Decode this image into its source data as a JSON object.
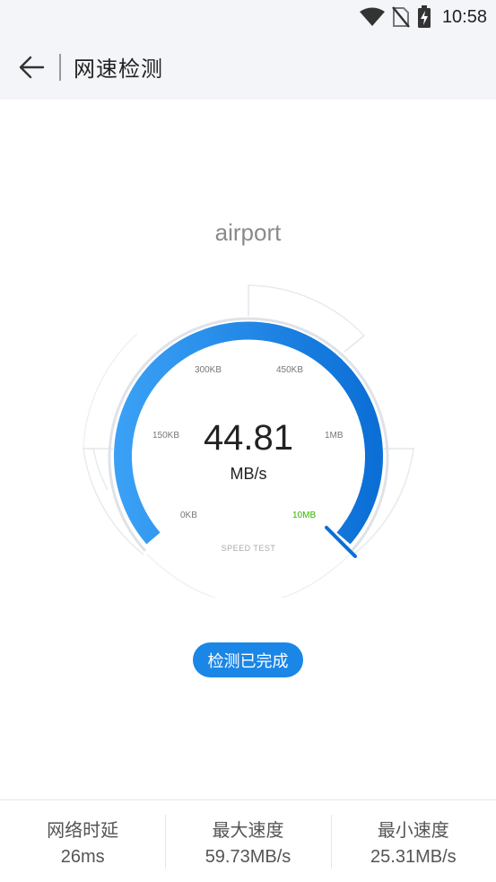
{
  "status_bar": {
    "time": "10:58",
    "icons": [
      "wifi-icon",
      "no-sim-icon",
      "battery-charging-icon"
    ]
  },
  "toolbar": {
    "back_icon": "arrow-left-icon",
    "title": "网速检测"
  },
  "network": {
    "name": "airport"
  },
  "gauge": {
    "value": "44.81",
    "unit": "MB/s",
    "caption": "SPEED TEST",
    "ticks": [
      "0KB",
      "150KB",
      "300KB",
      "450KB",
      "1MB",
      "10MB"
    ],
    "active_tick": "10MB",
    "fill_fraction": 1.0,
    "colors": {
      "arc_light": "#3aa0f5",
      "arc_dark": "#0b6fd6",
      "track": "#dfe3e8",
      "active_tick": "#38b000"
    }
  },
  "status_button": {
    "label": "检测已完成",
    "color": "#1a86e6"
  },
  "stats": [
    {
      "label": "网络时延",
      "value": "26ms"
    },
    {
      "label": "最大速度",
      "value": "59.73MB/s"
    },
    {
      "label": "最小速度",
      "value": "25.31MB/s"
    }
  ]
}
